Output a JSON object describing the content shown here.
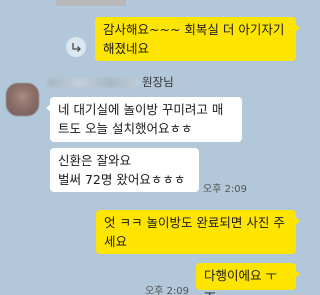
{
  "chat": {
    "messages": [
      {
        "sender": "me",
        "text": "감사해요~~~ 회복실 더 아기자기\n해졌네요"
      },
      {
        "sender": "other",
        "text": "네 대기실에 놀이방 꾸미려고 매\n트도 오늘 설치했어요ㅎㅎ"
      },
      {
        "sender": "other",
        "text": "신환은 잘와요\n벌써 72명 왔어요ㅎㅎㅎ"
      },
      {
        "sender": "me",
        "text": "엇 ㅋㅋ 놀이방도 완료되면 사진 주\n세요"
      },
      {
        "sender": "me",
        "text": "다행이에요 ㅜ ㅜ"
      }
    ],
    "sender": {
      "title": "원장님"
    },
    "times": {
      "other_group": "오후 2:09",
      "my_last": "오후 2:09"
    },
    "icons": {
      "share": "share-forward-icon",
      "avatar": "profile-avatar"
    },
    "colors": {
      "background": "#b2c7d9",
      "my_bubble": "#fee500",
      "their_bubble": "#ffffff"
    }
  }
}
